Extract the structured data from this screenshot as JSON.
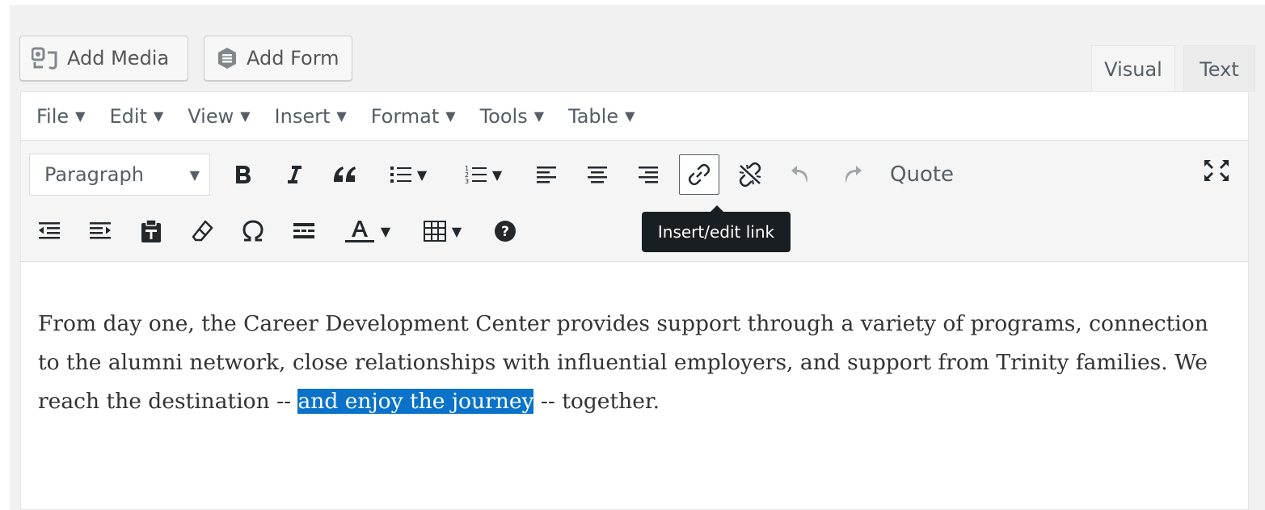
{
  "media_buttons": {
    "add_media": "Add Media",
    "add_form": "Add Form"
  },
  "mode_tabs": {
    "visual": "Visual",
    "text": "Text",
    "active": "Visual"
  },
  "menubar": {
    "items": [
      {
        "label": "File"
      },
      {
        "label": "Edit"
      },
      {
        "label": "View"
      },
      {
        "label": "Insert"
      },
      {
        "label": "Format"
      },
      {
        "label": "Tools"
      },
      {
        "label": "Table"
      }
    ]
  },
  "toolbar": {
    "format_select": "Paragraph",
    "quote_label": "Quote",
    "active_tool": "insert-edit-link",
    "icons_row1": [
      "bold-icon",
      "italic-icon",
      "blockquote-icon",
      "bullet-list-icon",
      "numbered-list-icon",
      "align-left-icon",
      "align-center-icon",
      "align-right-icon",
      "link-icon",
      "unlink-icon",
      "undo-icon",
      "redo-icon",
      "fullscreen-icon"
    ],
    "icons_row2": [
      "outdent-icon",
      "indent-icon",
      "paste-text-icon",
      "clear-formatting-icon",
      "special-character-icon",
      "horizontal-line-icon",
      "text-color-icon",
      "table-icon",
      "help-icon"
    ]
  },
  "tooltip": {
    "text": "Insert/edit link"
  },
  "content": {
    "before_selection": "From day one, the Career Development Center provides support through a variety of programs, connection to the alumni network, close relationships with influential employers, and support from Trinity families. We reach the destination -- ",
    "selected_text": "and enjoy the journey",
    "after_selection": " -- together."
  },
  "colors": {
    "selection": "#0a73c9",
    "tooltip_bg": "#191e23",
    "toolbar_bg": "#f5f5f5",
    "frame_bg": "#f1f1f1"
  }
}
